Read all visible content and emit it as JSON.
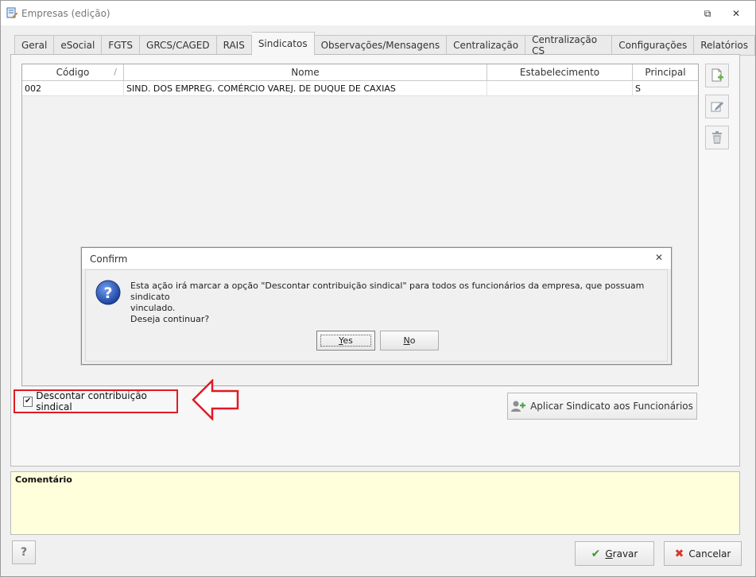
{
  "window": {
    "title": "Empresas (edição)",
    "restore_glyph": "⧉",
    "close_glyph": "✕",
    "icon": "form-edit-icon"
  },
  "tabs": [
    {
      "label": "Geral"
    },
    {
      "label": "eSocial"
    },
    {
      "label": "FGTS"
    },
    {
      "label": "GRCS/CAGED"
    },
    {
      "label": "RAIS"
    },
    {
      "label": "Sindicatos",
      "active": true
    },
    {
      "label": "Observações/Mensagens"
    },
    {
      "label": "Centralização"
    },
    {
      "label": "Centralização CS"
    },
    {
      "label": "Configurações"
    },
    {
      "label": "Relatórios"
    }
  ],
  "grid": {
    "columns": [
      "Código",
      "Nome",
      "Estabelecimento",
      "Principal"
    ],
    "sort_glyph": "/",
    "rows": [
      {
        "codigo": "002",
        "nome": "SIND. DOS EMPREG. COMÉRCIO VAREJ. DE DUQUE DE CAXIAS",
        "estabelecimento": "",
        "principal": "S"
      }
    ]
  },
  "side_buttons": [
    "add-document-icon",
    "edit-icon",
    "trash-icon"
  ],
  "checkbox": {
    "label": "Descontar contribuição sindical",
    "checked": true,
    "check_glyph": "✔"
  },
  "apply_button": {
    "label": "Aplicar Sindicato aos Funcionários",
    "icon": "add-user-icon"
  },
  "comment": {
    "label": "Comentário",
    "value": ""
  },
  "footer": {
    "help_label": "?",
    "save_label_first": "G",
    "save_label_rest": "ravar",
    "cancel_label": "Cancelar",
    "save_glyph": "✔",
    "cancel_glyph": "✖"
  },
  "dialog": {
    "title": "Confirm",
    "close_glyph": "✕",
    "message_line1": "Esta ação irá marcar a opção \"Descontar contribuição sindical\" para todos os funcionários da empresa, que possuam sindicato",
    "message_line2": "vinculado.",
    "message_line3": "Deseja continuar?",
    "yes_first": "Y",
    "yes_rest": "es",
    "no_first": "N",
    "no_rest": "o",
    "icon": "question-icon"
  },
  "colors": {
    "highlight_red": "#e01b24",
    "comment_bg": "#ffffdc",
    "save_green": "#3a9a2a",
    "cancel_red": "#d9372b"
  }
}
